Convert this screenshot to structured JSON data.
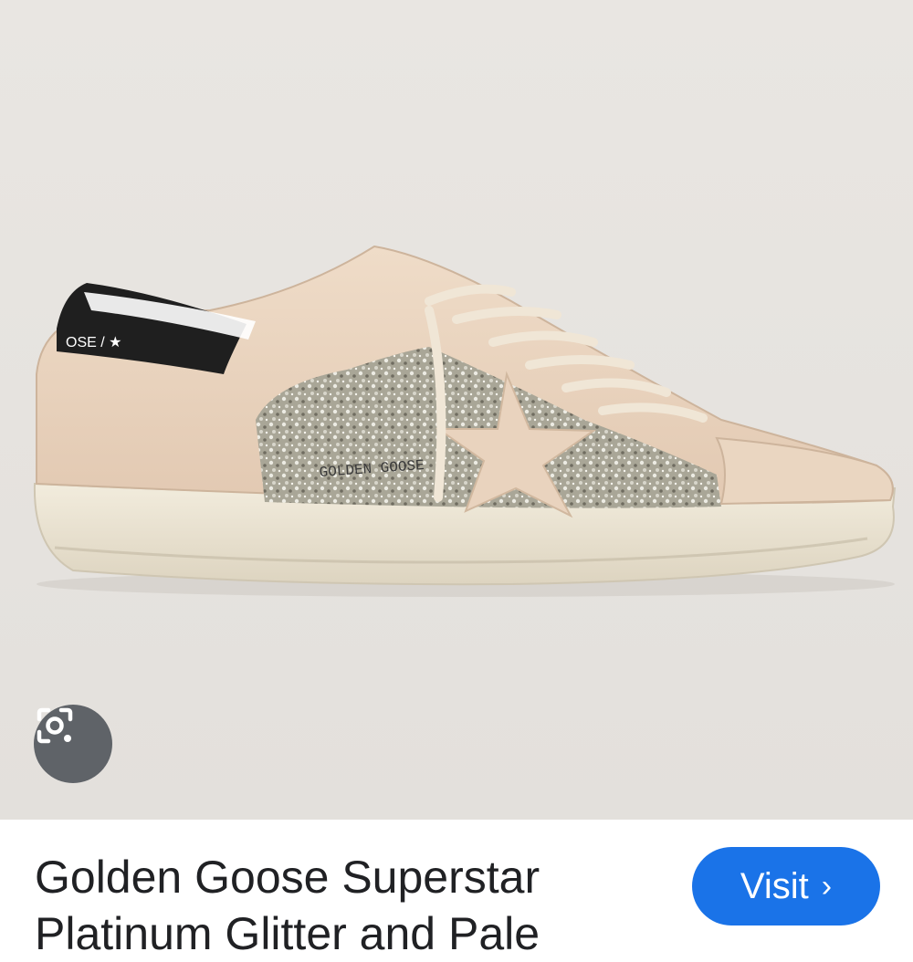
{
  "result": {
    "image": {
      "subject": "shoe-photo",
      "brand_text_heel": "OSE / ★",
      "brand_text_side": "GOLDEN GOOSE"
    },
    "lens": {
      "icon": "lens-icon"
    },
    "title": "Golden Goose Superstar Platinum Glitter and Pale",
    "visit": {
      "label": "Visit",
      "icon": "chevron-right-icon"
    }
  },
  "colors": {
    "background": "#e6e3df",
    "suede": "#e9d3be",
    "sole": "#ece6d6",
    "heel_tab": "#1f1f1f",
    "glitter": "#b9b6a8",
    "visit_button": "#1a73e8",
    "lens_button": "#5f6368"
  }
}
